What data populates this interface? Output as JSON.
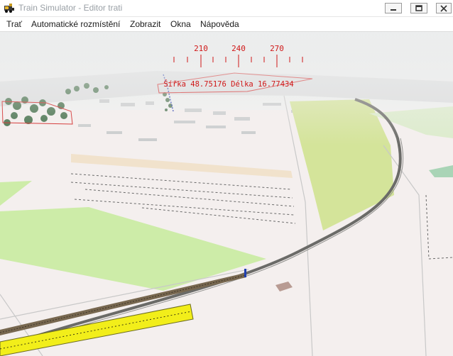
{
  "window": {
    "title": "Train Simulator - Editor trati"
  },
  "titlebar_buttons": {
    "minimize_icon": "minimize-icon",
    "maximize_icon": "maximize-icon",
    "close_icon": "close-icon"
  },
  "menu": {
    "items": [
      {
        "label": "Trať"
      },
      {
        "label": "Automatické rozmístění"
      },
      {
        "label": "Zobrazit"
      },
      {
        "label": "Okna"
      },
      {
        "label": "Nápověda"
      }
    ]
  },
  "compass": {
    "labels": [
      "210",
      "240",
      "270"
    ],
    "color": "#d01818"
  },
  "coordinates": {
    "text": "Šířka 48.75176 Délka 16.77434"
  },
  "colors": {
    "terrain": "#f4efee",
    "field_green": "#d4e49a",
    "grass_green": "#cdeca8",
    "rail": "#6b6b68",
    "track_selected": "#f2ee1a",
    "hud": "#d01818"
  }
}
